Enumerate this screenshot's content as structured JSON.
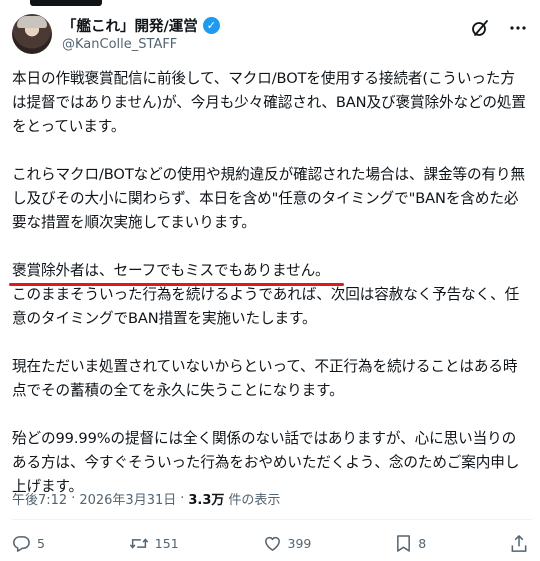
{
  "author": {
    "display_name": "「艦これ」開発/運営",
    "handle": "@KanColle_STAFF",
    "verified": true
  },
  "post": {
    "paragraphs": [
      "本日の作戦褒賞配信に前後して、マクロ/BOTを使用する接続者(こういった方は提督ではありません)が、今月も少々確認され、BAN及び褒賞除外などの処置をとっています。",
      "これらマクロ/BOTなどの使用や規約違反が確認された場合は、課金等の有り無し及びその大小に関わらず、本日を含め\"任意のタイミングで\"BANを含めた必要な措置を順次実施してまいります。",
      "褒賞除外者は、セーフでもミスでもありません。",
      "このままそういった行為を続けるようであれば、次回は容赦なく予告なく、任意のタイミングでBAN措置を実施いたします。",
      "現在ただいま処置されていないからといって、不正行為を続けることはある時点でその蓄積の全てを永久に失うことになります。",
      "殆どの99.99%の提督には全く関係のない話ではありますが、心に思い当りのある方は、今すぐそういった行為をおやめいただくよう、念のためご案内申し上げます。"
    ]
  },
  "meta": {
    "time": "午後7:12",
    "separator": "·",
    "date": "2026年3月31日",
    "views_count": "3.3万",
    "views_label": "件の表示"
  },
  "engagement": {
    "replies": "5",
    "reposts": "151",
    "likes": "399",
    "bookmarks": "8"
  },
  "colors": {
    "accent": "#1d9bf0",
    "underline": "#e0191d",
    "secondary_text": "#536471"
  },
  "icons": {
    "grok": "grok-icon",
    "more": "more-icon",
    "reply": "reply-icon",
    "repost": "repost-icon",
    "like": "like-icon",
    "bookmark": "bookmark-icon",
    "share": "share-icon"
  }
}
